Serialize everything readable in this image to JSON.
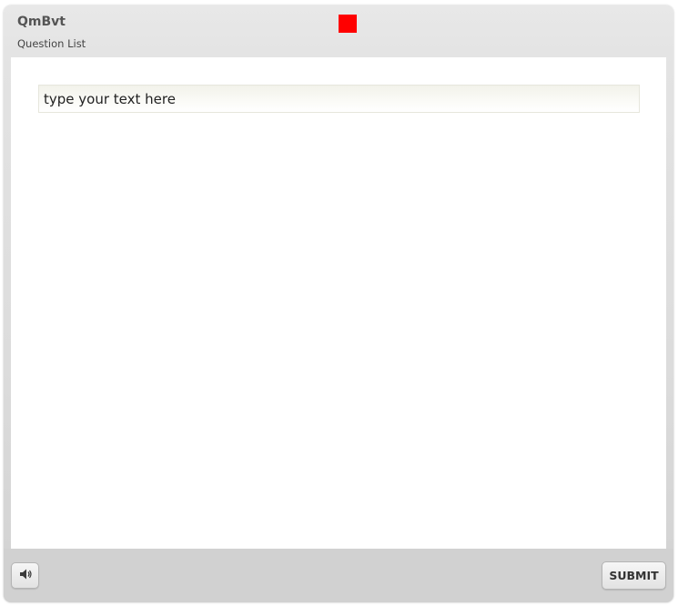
{
  "header": {
    "title": "QmBvt",
    "subtitle": "Question List",
    "marker_color": "#ff0000"
  },
  "answer": {
    "value": "",
    "placeholder": "type your text here"
  },
  "footer": {
    "audio_icon": "speaker-icon",
    "submit_label": "SUBMIT"
  },
  "colors": {
    "frame": "#e3e3e3",
    "footer": "#d1d1d1",
    "content": "#ffffff",
    "marker": "#ff0000"
  }
}
